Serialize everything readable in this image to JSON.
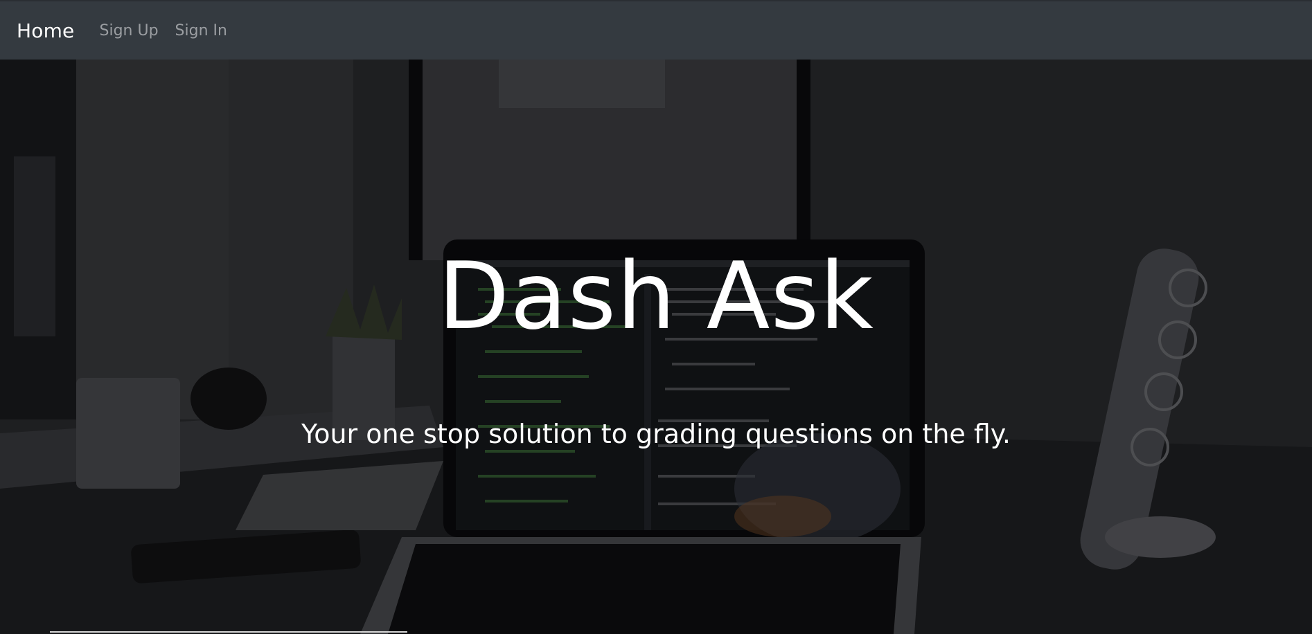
{
  "navbar": {
    "brand": "Home",
    "links": [
      "Sign Up",
      "Sign In"
    ]
  },
  "hero": {
    "title": "Dash Ask",
    "subtitle": "Your one stop solution to grading questions on the fly.",
    "background_image": "desk-laptop-code-photo"
  },
  "colors": {
    "navbar_bg": "#343a40",
    "brand_text": "#ffffff",
    "nav_link_text": "#9a9da1",
    "hero_text": "#ffffff"
  }
}
